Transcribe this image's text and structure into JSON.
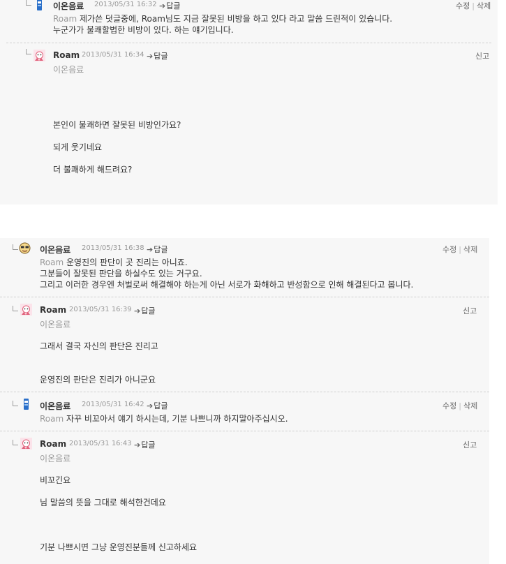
{
  "ui": {
    "reply_label": "답글",
    "edit_label": "수정",
    "delete_label": "삭제",
    "report_label": "신고"
  },
  "panel1": {
    "c1": {
      "author": "이온음료",
      "date": "2013/05/31 16:32",
      "mention": "Roam",
      "line1": " 제가쓴 덧글중에, Roam님도 지금 잘못된 비방을 하고 있다 라고 말씀 드린적이 있습니다.",
      "line2": "누군가가 불쾌할법한 비방이 있다. 하는 얘기입니다."
    },
    "c2": {
      "author": "Roam",
      "date": "2013/05/31 16:34",
      "reply_to": "이온음료",
      "line1": "본인이 불쾌하면 잘못된 비방인가요?",
      "line2": "되게 웃기네요",
      "line3": "더 불쾌하게 해드려요?"
    }
  },
  "panel2": {
    "c1": {
      "author": "이온음료",
      "date": "2013/05/31 16:38",
      "mention": "Roam",
      "line1": " 운영진의 판단이 곳 진리는 아니죠.",
      "line2": "그분들이 잘못된 판단을 하실수도 있는 거구요.",
      "line3": "그리고 이러한 경우엔 처벌로써 해결해야 하는게 아닌 서로가 화해하고 반성함으로 인해 해결된다고 봅니다."
    },
    "c2": {
      "author": "Roam",
      "date": "2013/05/31 16:39",
      "reply_to": "이온음료",
      "line1": "그래서 결국 자신의 판단은 진리고",
      "line2": "운영진의 판단은 진리가 아니군요"
    },
    "c3": {
      "author": "이온음료",
      "date": "2013/05/31 16:42",
      "mention": "Roam",
      "line1": " 자꾸 비꼬아서 얘기 하시는데, 기분 나쁘니까 하지말아주십시오."
    },
    "c4": {
      "author": "Roam",
      "date": "2013/05/31 16:43",
      "reply_to": "이온음료",
      "line1": "비꼬긴요",
      "line2": "님 말씀의 뜻을 그대로 해석한건데요",
      "line3": "기분 나쁘시면 그냥 운영진분들께 신고하세요"
    }
  }
}
